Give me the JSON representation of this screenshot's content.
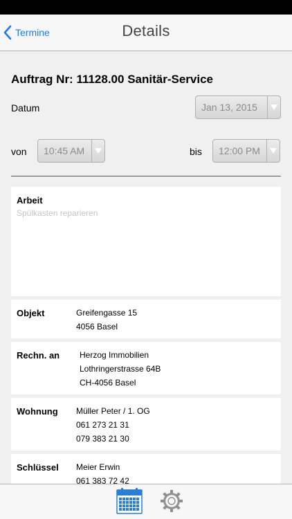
{
  "nav": {
    "back_label": "Termine",
    "title": "Details"
  },
  "order": {
    "title": "Auftrag Nr: 11128.00 Sanitär-Service"
  },
  "date": {
    "label": "Datum",
    "value": "Jan 13, 2015"
  },
  "time": {
    "from_label": "von",
    "from_value": "10:45 AM",
    "to_label": "bis",
    "to_value": "12:00 PM"
  },
  "arbeit": {
    "label": "Arbeit",
    "placeholder": "Spülkasten reparieren"
  },
  "objekt": {
    "label": "Objekt",
    "lines": [
      "Greifengasse 15",
      "4056 Basel"
    ]
  },
  "rechnung": {
    "label": "Rechn. an",
    "lines": [
      "Herzog Immobilien",
      "Lothringerstrasse 64B",
      "CH-4056 Basel"
    ]
  },
  "wohnung": {
    "label": "Wohnung",
    "lines": [
      "Müller Peter / 1. OG",
      "061 273 21 31",
      "079 383 21 30"
    ]
  },
  "schluessel": {
    "label": "Schlüssel",
    "lines": [
      "Meier Erwin",
      "061 383 72 42"
    ]
  },
  "tabs": {
    "active": "calendar",
    "items": [
      "calendar-icon",
      "gear-icon"
    ]
  },
  "colors": {
    "accent": "#1a7cf0",
    "active_tab": "#2a7fd4",
    "inactive_tab": "#8e8e8e"
  }
}
